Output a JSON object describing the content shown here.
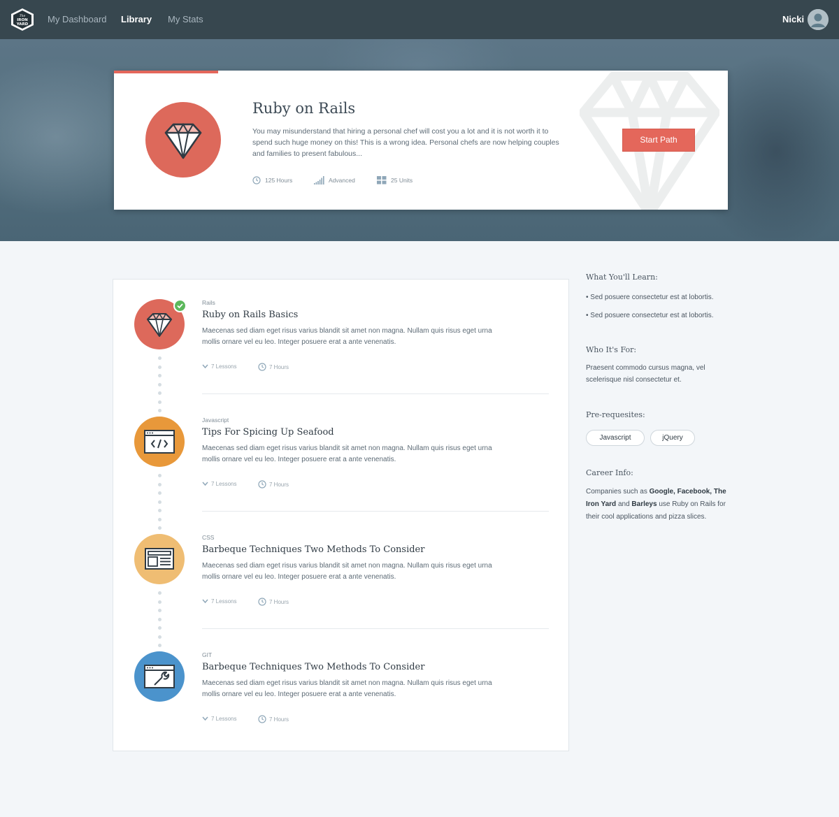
{
  "nav": {
    "logo_text": "The IRON YARD",
    "links": [
      "My Dashboard",
      "Library",
      "My Stats"
    ],
    "active": "Library",
    "user": "Nicki"
  },
  "hero": {
    "title": "Ruby on Rails",
    "description": "You may misunderstand that hiring a personal chef will cost you a lot and it is not worth it to spend such huge money on this! This is a wrong idea. Personal chefs are now helping couples and families to present fabulous...",
    "hours": "125 Hours",
    "level": "Advanced",
    "units": "25 Units",
    "button": "Start Path",
    "progress": 0.17,
    "colors": {
      "accent": "#e4675b"
    }
  },
  "courses": [
    {
      "category": "Rails",
      "title": "Ruby on Rails Basics",
      "description": "Maecenas sed diam eget risus varius blandit sit amet non magna. Nullam quis risus eget urna mollis ornare vel eu leo. Integer posuere erat a ante venenatis.",
      "lessons": "7 Lessons",
      "hours": "7 Hours",
      "icon": "diamond-icon",
      "color": "#dd695b",
      "completed": true
    },
    {
      "category": "Javascript",
      "title": "Tips For Spicing Up Seafood",
      "description": "Maecenas sed diam eget risus varius blandit sit amet non magna. Nullam quis risus eget urna mollis ornare vel eu leo. Integer posuere erat a ante venenatis.",
      "lessons": "7 Lessons",
      "hours": "7 Hours",
      "icon": "code-window-icon",
      "color": "#e8983a",
      "completed": false
    },
    {
      "category": "CSS",
      "title": "Barbeque Techniques Two Methods To Consider",
      "description": "Maecenas sed diam eget risus varius blandit sit amet non magna. Nullam quis risus eget urna mollis ornare vel eu leo. Integer posuere erat a ante venenatis.",
      "lessons": "7 Lessons",
      "hours": "7 Hours",
      "icon": "layout-icon",
      "color": "#efbd73",
      "completed": false
    },
    {
      "category": "GIT",
      "title": "Barbeque Techniques Two Methods To Consider",
      "description": "Maecenas sed diam eget risus varius blandit sit amet non magna. Nullam quis risus eget urna mollis ornare vel eu leo. Integer posuere erat a ante venenatis.",
      "lessons": "7 Lessons",
      "hours": "7 Hours",
      "icon": "wrench-window-icon",
      "color": "#4b93cc",
      "completed": false
    }
  ],
  "sidebar": {
    "learn_heading": "What You'll Learn:",
    "learn_items": [
      "• Sed posuere consectetur est at lobortis.",
      "• Sed posuere consectetur est at lobortis."
    ],
    "who_heading": "Who It's For:",
    "who_text": "Praesent commodo cursus magna, vel scelerisque nisl consectetur et.",
    "prereq_heading": "Pre-requesites:",
    "prereqs": [
      "Javascript",
      "jQuery"
    ],
    "career_heading": "Career Info:",
    "career_prefix": "Companies such as ",
    "career_companies_1": "Google, Facebook, The Iron Yard",
    "career_and": " and ",
    "career_companies_2": "Barleys",
    "career_suffix": " use Ruby on Rails for their cool applications and pizza slices."
  }
}
